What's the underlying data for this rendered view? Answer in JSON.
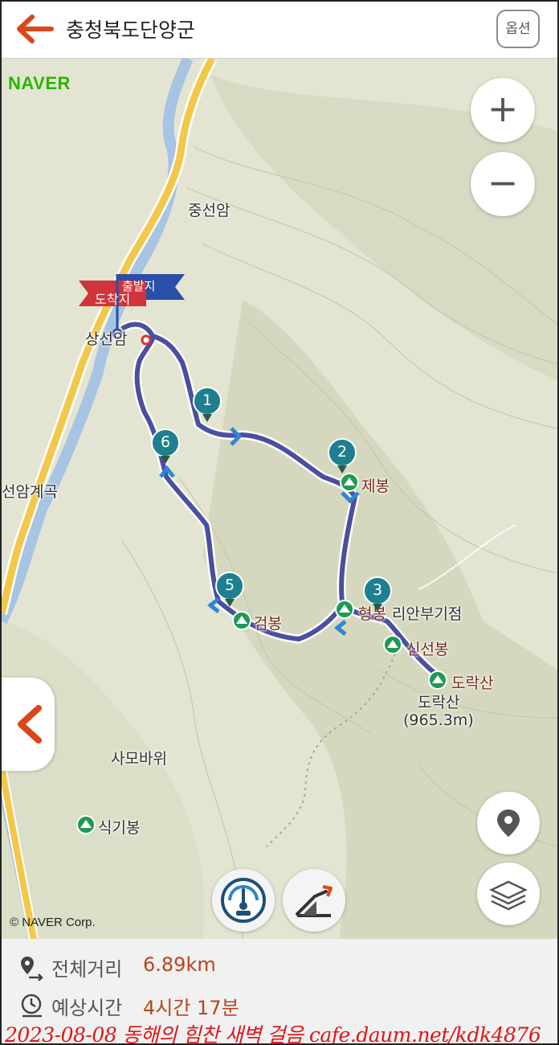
{
  "header": {
    "title": "충청북도단양군",
    "options_label": "옵션"
  },
  "map": {
    "brand": "NAVER",
    "copyright": "© NAVER Corp.",
    "zoom_in": "+",
    "zoom_out": "−",
    "flag_finish": "도착지",
    "flag_start": "출발지",
    "labels": {
      "jungseonam": "중선암",
      "sangseonam": "상선암",
      "amgyegok": "선암계곡",
      "samobawi": "사모바위",
      "sikgibong": "식기봉",
      "doraksan_name": "도락산",
      "doraksan_height": "(965.3m)"
    },
    "peaks": {
      "jebong": "제봉",
      "hyeongbong": "형봉",
      "geombong": "검봉",
      "sinseonbong": "신선봉",
      "doraksan": "도락산",
      "hyeongbong_suffix": "리안부기점"
    },
    "waypoints": [
      "1",
      "2",
      "3",
      "5",
      "6"
    ]
  },
  "summary": {
    "distance_label": "전체거리",
    "distance_value": "6.89km",
    "time_label": "예상시간",
    "time_value": "4시간 17분"
  },
  "watermark": "2023-08-08 동해의 힘찬 새벽 걸음 cafe.daum.net/kdk4876",
  "colors": {
    "accent": "#d9481a",
    "route": "#4a4f9e",
    "peak_green": "#1f9a55",
    "waypoint_teal": "#1d7f8f",
    "finish_flag": "#d0333a",
    "start_flag": "#2a4fa8",
    "road_yellow": "#f2c84b",
    "river_blue": "#a7c4e2"
  }
}
